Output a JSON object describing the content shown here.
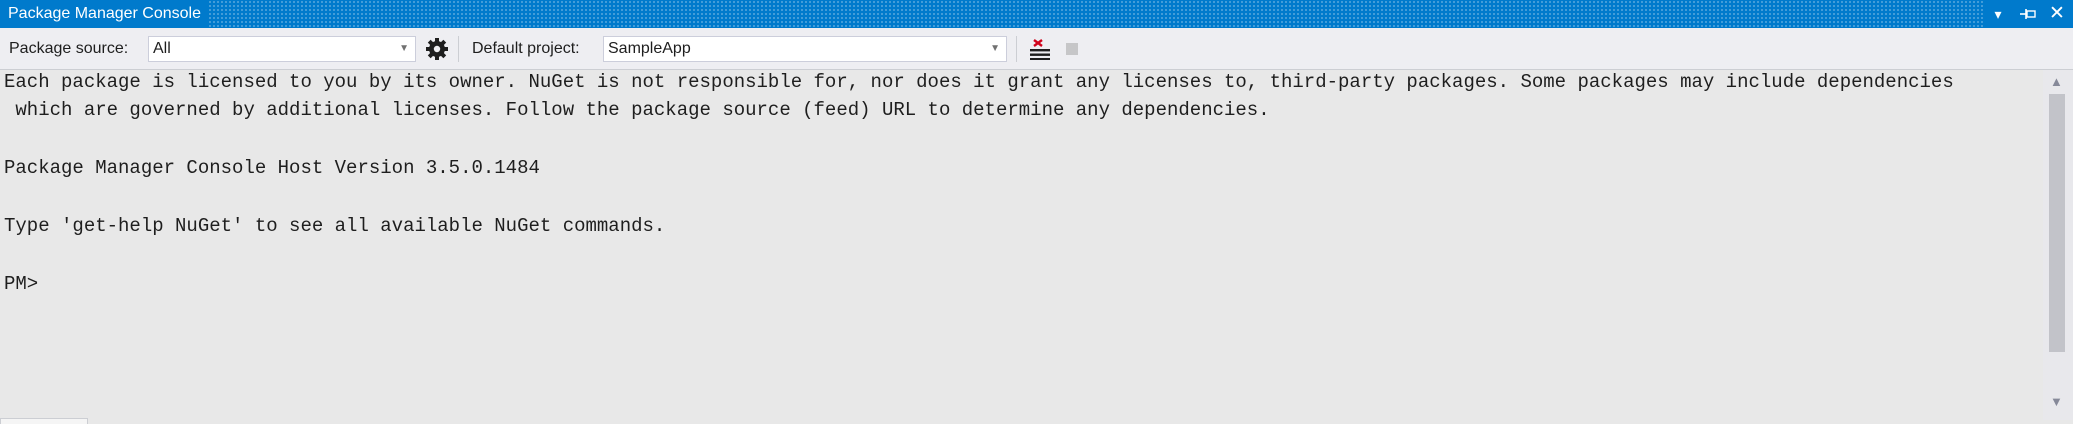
{
  "window": {
    "title": "Package Manager Console"
  },
  "title_controls": {
    "dropdown": "▾",
    "pin": "⊣⊓",
    "close": "✕"
  },
  "toolbar": {
    "package_source_label": "Package source:",
    "package_source_value": "All",
    "default_project_label": "Default project:",
    "default_project_value": "SampleApp"
  },
  "console": {
    "lines": [
      "Each package is licensed to you by its owner. NuGet is not responsible for, nor does it grant any licenses to, third-party packages. Some packages may include dependencies",
      " which are governed by additional licenses. Follow the package source (feed) URL to determine any dependencies.",
      "Package Manager Console Host Version 3.5.0.1484",
      "Type 'get-help NuGet' to see all available NuGet commands.",
      "PM>"
    ]
  },
  "colors": {
    "titlebar": "#007acc",
    "console_bg": "#e8e8e8",
    "toolbar_bg": "#eeeef2",
    "clear_icon_red": "#d0021b"
  }
}
